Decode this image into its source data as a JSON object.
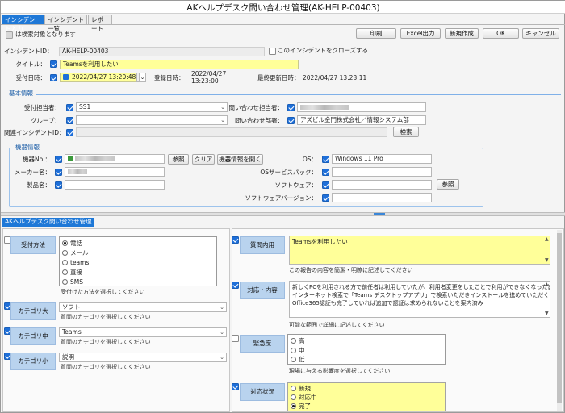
{
  "window": {
    "title": "AKヘルプデスク問い合わせ管理(AK-HELP-00403)"
  },
  "tabs": [
    "インシデント入力",
    "インシデント一覧",
    "レポート"
  ],
  "search_note": "は検索対象となります",
  "toolbar": {
    "print": "印刷",
    "excel": "Excel出力",
    "new": "新規作成",
    "ok": "OK",
    "cancel": "キャンセル"
  },
  "header": {
    "incident_id_label": "インシデントID：",
    "incident_id": "AK-HELP-00403",
    "close_label": "このインシデントをクローズする",
    "title_label": "タイトル：",
    "title": "Teamsを利用したい",
    "received_label": "受付日時：",
    "received": "2022/04/27 13:20:48",
    "registered_label": "登録日時：",
    "registered_date": "2022/04/27",
    "registered_time": "13:23:00",
    "updated_label": "最終更新日時：",
    "updated": "2022/04/27 13:23:11"
  },
  "basic": {
    "section": "基本情報",
    "assignee_label": "受付担当者：",
    "assignee": "SS1",
    "group_label": "グループ：",
    "group": "",
    "related_label": "関連インシデントID：",
    "inquirer_label": "問い合わせ担当者：",
    "dept_label": "問い合わせ部署：",
    "dept": "アズビル金門株式会社／情報システム部",
    "search_button": "検索"
  },
  "device": {
    "section": "機器情報",
    "no_label": "機器No.：",
    "maker_label": "メーカー名：",
    "product_label": "製品名：",
    "browse": "参照",
    "clear": "クリア",
    "open_info": "機器情報を開く",
    "os_label": "OS：",
    "os": "Windows 11 Pro",
    "sp_label": "OSサービスパック：",
    "sw_label": "ソフトウェア：",
    "swver_label": "ソフトウェアバージョン：",
    "sw_browse": "参照"
  },
  "panel_tab": "AKヘルプデスク問い合わせ管理",
  "left": {
    "method_label": "受付方法",
    "methods": [
      "電話",
      "メール",
      "teams",
      "直接",
      "SMS"
    ],
    "method_hint": "受付けた方法を選択してください",
    "cat_l_label": "カテゴリ大",
    "cat_l": "ソフト",
    "cat_l_hint": "質問のカテゴリを選択してください",
    "cat_m_label": "カテゴリ中",
    "cat_m": "Teams",
    "cat_m_hint": "質問のカテゴリを選択してください",
    "cat_s_label": "カテゴリ小",
    "cat_s": "説明",
    "cat_s_hint": "質問のカテゴリを選択してください"
  },
  "right": {
    "question_label": "質問内用",
    "question": "Teamsを利用したい",
    "question_hint": "この報告の内容を簡潔・明瞭に記述してください",
    "response_label": "対応・内容",
    "response_lines": [
      "新しくPCを利用される方で前任者は利用していたが、利用者変更をしたことで利用ができなくなった旨を確認。",
      "インターネット検索で「Teams デスクトップアプリ」で検索いただきインストールを進めていただくようおつたえ",
      "Office365認証も完了していれば追加で認証は求められないことを案内済み"
    ],
    "response_hint": "可能な範囲で詳細に記述してください",
    "urgency_label": "緊急度",
    "urgencies": [
      "高",
      "中",
      "低"
    ],
    "urgency_hint": "現場に与える影響度を選択してください",
    "status_label": "対応状況",
    "statuses": [
      "新規",
      "対応中",
      "完了"
    ]
  },
  "colors": {
    "accent": "#1e78d7",
    "highlight": "#ffff99",
    "label_bg": "#b9d3ee"
  }
}
